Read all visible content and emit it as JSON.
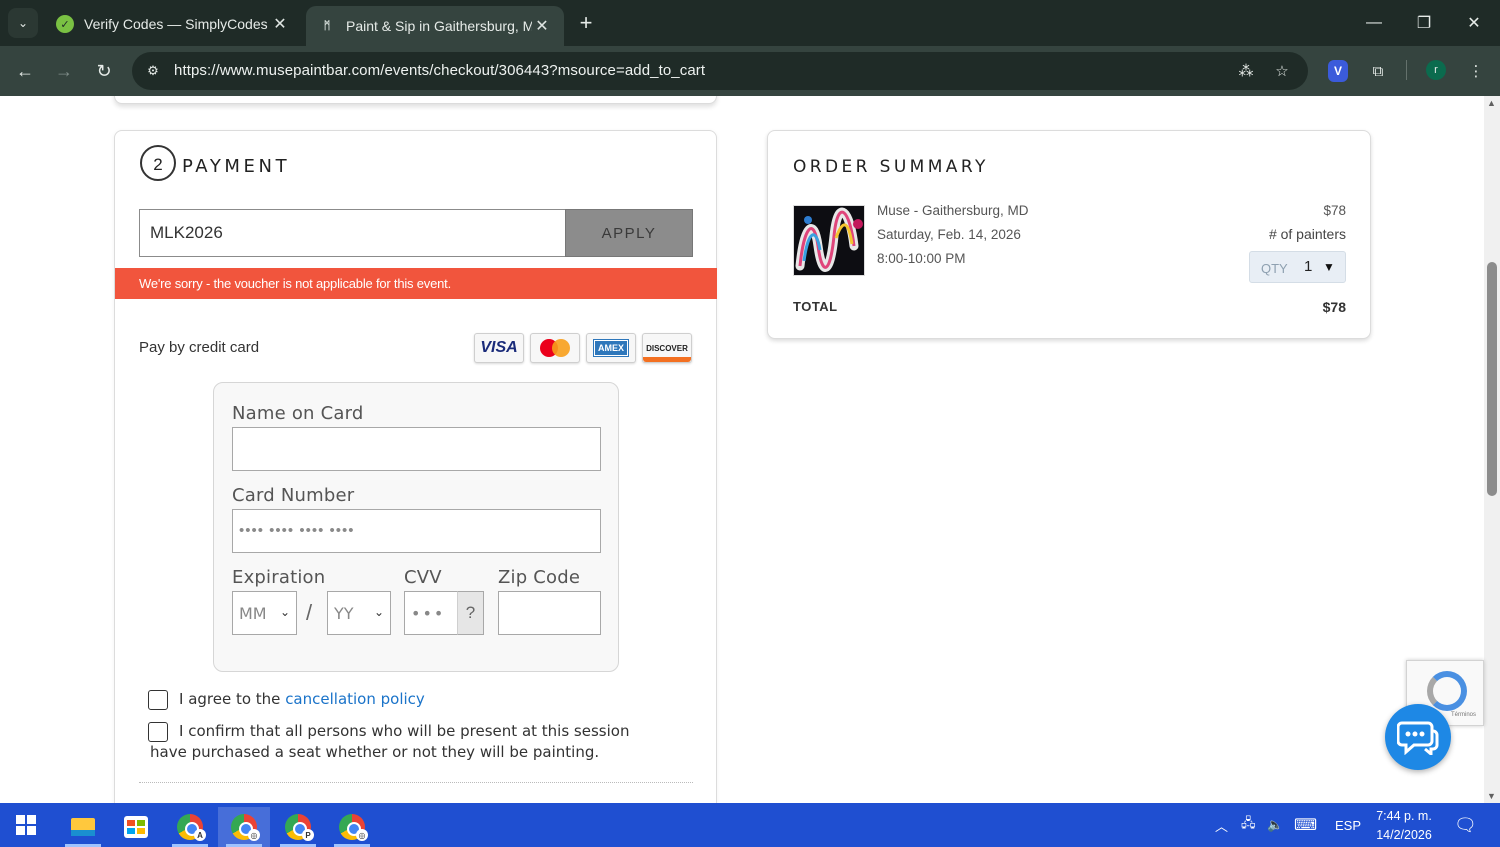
{
  "browser": {
    "tabs": [
      {
        "title": "Verify Codes — SimplyCodes",
        "active": false
      },
      {
        "title": "Paint & Sip in Gaithersburg, MD",
        "active": true
      }
    ],
    "url": "https://www.musepaintbar.com/events/checkout/306443?msource=add_to_cart",
    "profile_initial": "r"
  },
  "payment": {
    "step_number": "2",
    "title": "PAYMENT",
    "voucher_value": "MLK2026",
    "apply_label": "APPLY",
    "error_message": "We're sorry - the voucher is not applicable for this event.",
    "pay_by_card_label": "Pay by credit card",
    "card_brands": [
      "VISA",
      "Mastercard",
      "AMEX",
      "DISCOVER"
    ],
    "name_label": "Name on Card",
    "name_value": "",
    "card_number_label": "Card Number",
    "card_number_placeholder": "•••• •••• •••• ••••",
    "expiration_label": "Expiration",
    "month_placeholder": "MM",
    "year_placeholder": "YY",
    "date_separator": "/",
    "cvv_label": "CVV",
    "cvv_placeholder": "•••",
    "cvv_help": "?",
    "zip_label": "Zip Code",
    "zip_value": "",
    "agree_prefix": "I agree to the ",
    "agree_link": "cancellation policy",
    "confirm_text": "I confirm that all persons who will be present at this session have purchased a seat whether or not they will be painting."
  },
  "order_summary": {
    "title": "ORDER SUMMARY",
    "location": "Muse - Gaithersburg, MD",
    "date": "Saturday, Feb. 14, 2026",
    "time": "8:00-10:00 PM",
    "price": "$78",
    "painters_label": "# of painters",
    "qty_label": "QTY",
    "qty_value": "1",
    "total_label": "TOTAL",
    "total_value": "$78"
  },
  "recaptcha": {
    "terms": "Términos"
  },
  "taskbar": {
    "language": "ESP",
    "time": "7:44 p. m.",
    "date": "14/2/2026"
  },
  "colors": {
    "error": "#f1553d",
    "apply_button": "#8c8c8c",
    "link": "#1a73c9",
    "taskbar": "#1f4fd1",
    "chrome_frame": "#1f2b27",
    "chat": "#1e88e5"
  }
}
